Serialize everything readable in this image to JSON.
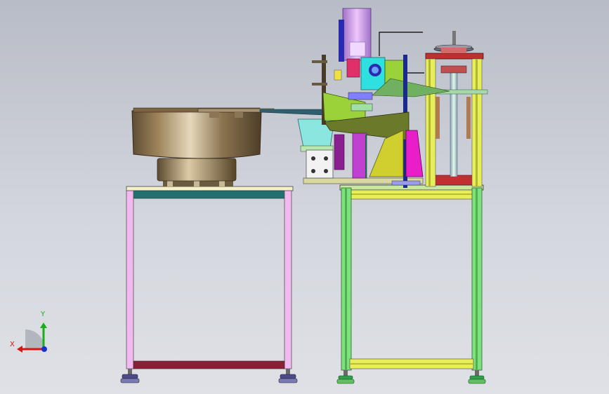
{
  "viewport": {
    "background_top": "#b8bcc6",
    "background_bottom": "#dfe1e6"
  },
  "triad": {
    "x_label": "X",
    "y_label": "Y",
    "x_color": "#d01818",
    "y_color": "#18b018",
    "z_color": "#1830d0"
  },
  "assembly": {
    "components": [
      "vibratory-feeder-bowl",
      "feeder-stand",
      "linear-feed-track",
      "cylinder-press-unit",
      "machine-frame",
      "handwheel-column",
      "leveling-feet"
    ],
    "colors": {
      "bowl_bronze": "#9c835a",
      "feeder_stand_pink": "#f2b8f0",
      "feeder_stand_crossbar": "#207070",
      "feeder_stand_base": "#8a1f35",
      "frame_green": "#7fe07f",
      "frame_yellow": "#e8ee5a",
      "cylinder_violet": "#d8a4f0",
      "block_cyan": "#2fe0e0",
      "plate_yellowgreen": "#9bd23a",
      "slab_magenta": "#e81ec8",
      "column_brown": "#b07a52",
      "column_red": "#c03030",
      "leveling_foot": "#4a4a8c"
    }
  }
}
